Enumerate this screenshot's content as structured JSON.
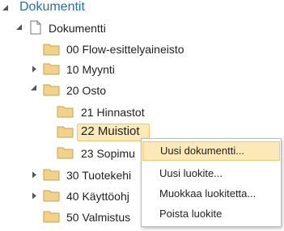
{
  "tree": {
    "root_label": "Dokumentit",
    "root_node": {
      "label": "Dokumentti",
      "icon": "document-icon"
    },
    "nodes": [
      {
        "id": "00",
        "label": "00 Flow-esittelyaineisto",
        "expandable": false,
        "depth": 1
      },
      {
        "id": "10",
        "label": "10 Myynti",
        "expandable": true,
        "expanded": false,
        "depth": 1
      },
      {
        "id": "20",
        "label": "20 Osto",
        "expandable": true,
        "expanded": true,
        "depth": 1
      },
      {
        "id": "21",
        "label": "21 Hinnastot",
        "expandable": false,
        "depth": 2
      },
      {
        "id": "22",
        "label": "22 Muistiot",
        "expandable": false,
        "depth": 2,
        "selected": true
      },
      {
        "id": "23",
        "label": "23 Sopimu",
        "expandable": false,
        "depth": 2
      },
      {
        "id": "30",
        "label": "30 Tuotekehi",
        "expandable": true,
        "expanded": false,
        "depth": 1
      },
      {
        "id": "40",
        "label": "40 Käyttöohj",
        "expandable": true,
        "expanded": false,
        "depth": 1
      },
      {
        "id": "50",
        "label": "50 Valmistus",
        "expandable": false,
        "depth": 1
      }
    ]
  },
  "context_menu": {
    "items": [
      {
        "label": "Uusi dokumentti...",
        "highlighted": true
      },
      {
        "label": "Uusi luokite...",
        "highlighted": false
      },
      {
        "label": "Muokkaa luokitetta...",
        "highlighted": false
      },
      {
        "label": "Poista luokite",
        "highlighted": false
      }
    ]
  },
  "colors": {
    "root_text": "#2a6fb0",
    "folder_fill": "#f2d28a",
    "folder_stroke": "#c9a24b",
    "selection_bg": "#fde8b7",
    "selection_border": "#f3c66a"
  }
}
